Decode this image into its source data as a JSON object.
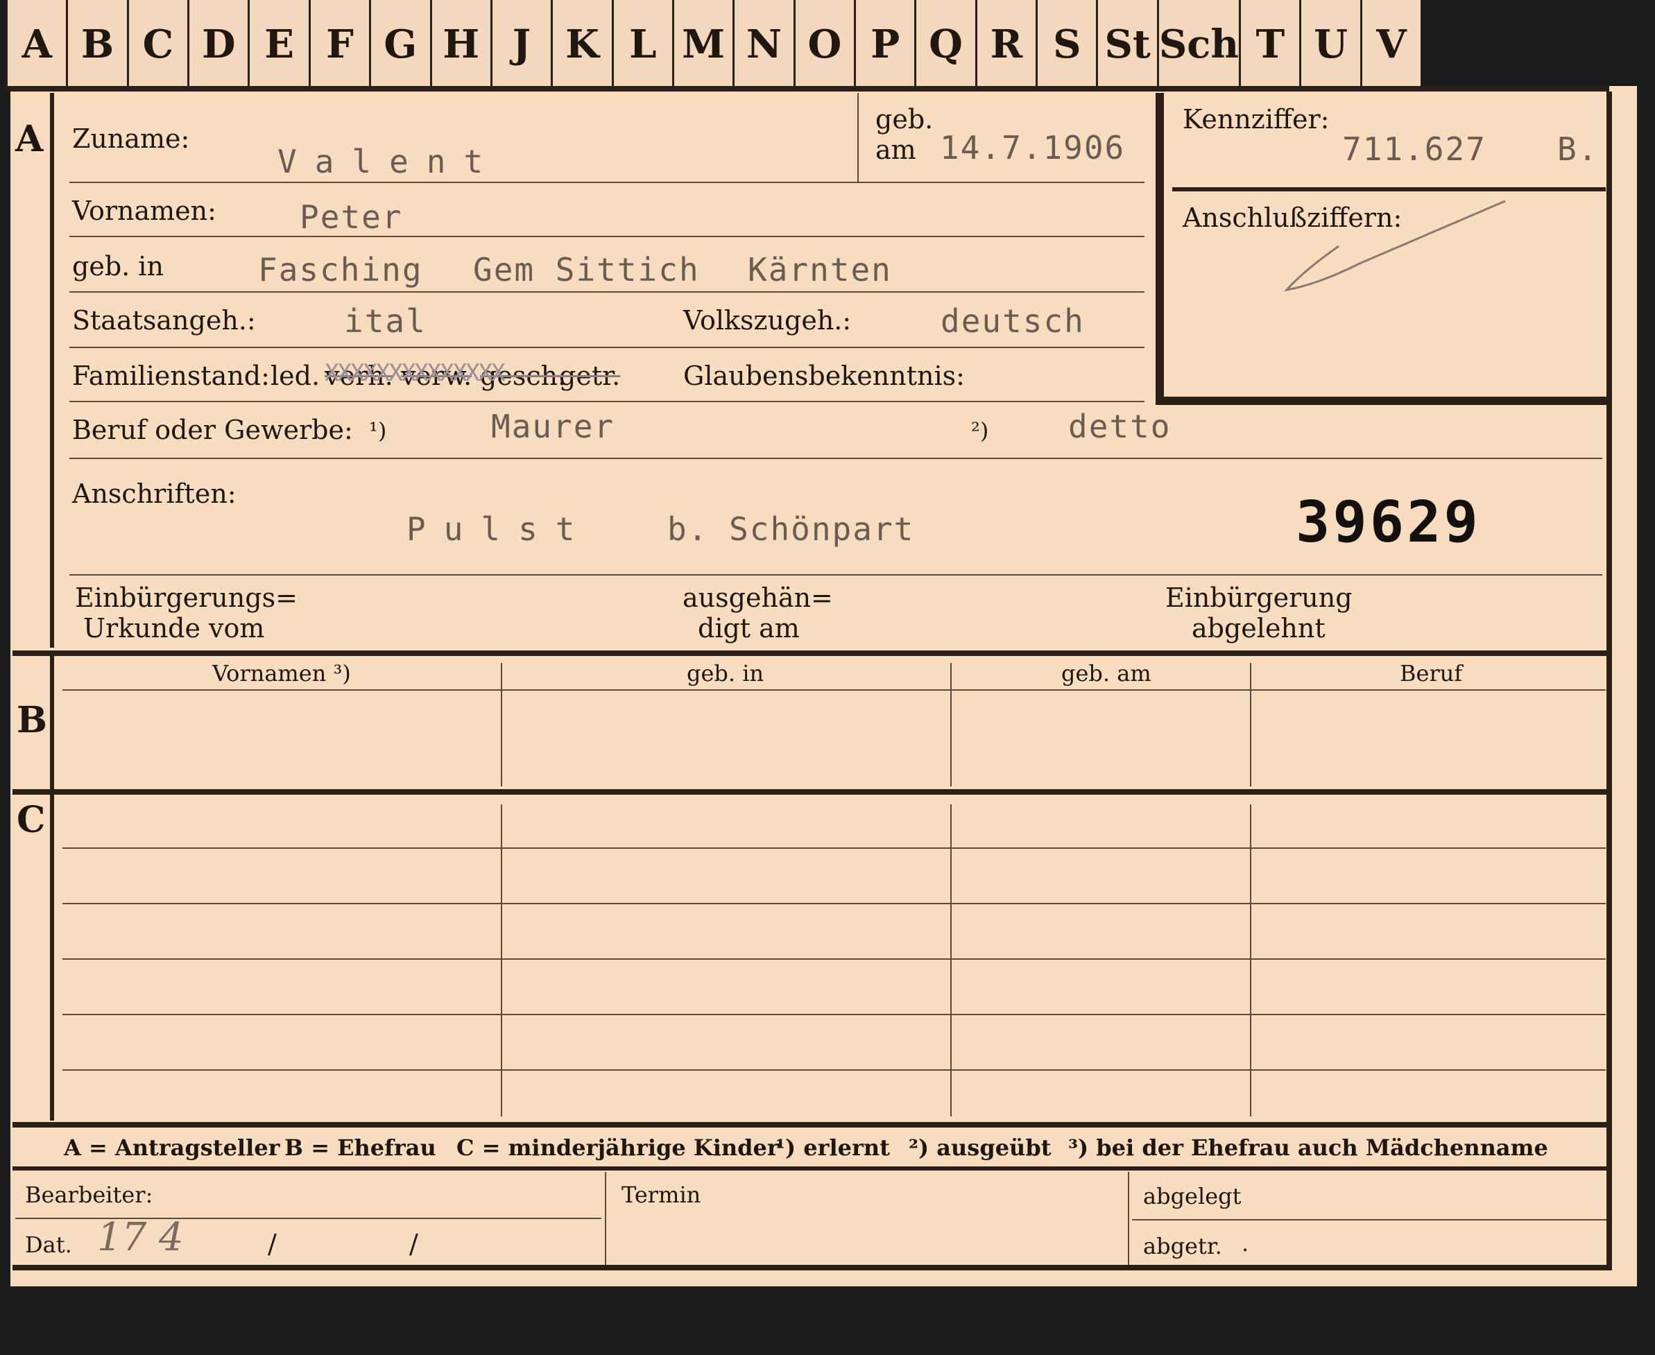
{
  "tabs": [
    "A",
    "B",
    "C",
    "D",
    "E",
    "F",
    "G",
    "H",
    "J",
    "K",
    "L",
    "M",
    "N",
    "O",
    "P",
    "Q",
    "R",
    "S",
    "St",
    "Sch",
    "T",
    "U",
    "V"
  ],
  "section_a": {
    "label": "A",
    "zuname_label": "Zuname:",
    "zuname": "Valent",
    "geb_label": "geb.",
    "am_label": "am",
    "geb_datum": "14.7.1906",
    "vornamen_label": "Vornamen:",
    "vornamen": "Peter",
    "gebin_label": "geb. in",
    "gebin_place": "Fasching",
    "gebin_gem": "Gem Sittich",
    "gebin_land": "Kärnten",
    "staat_label": "Staatsangeh.:",
    "staat": "ital",
    "volk_label": "Volkszugeh.:",
    "volk": "deutsch",
    "familie_label": "Familienstand:",
    "familie_led": "led.",
    "familie_verh": "verh.",
    "familie_verw": "verw.",
    "familie_gesch": "gesch.",
    "familie_getr": "getr.",
    "familie_xs": "XXXXXXXXXXXXXX",
    "glaube_label": "Glaubensbekenntnis:",
    "beruf_label": "Beruf oder Gewerbe:",
    "beruf_note1": "¹)",
    "beruf1": "Maurer",
    "beruf_note2": "²)",
    "beruf2": "detto",
    "anschrift_label": "Anschriften:",
    "anschrift": "Pulst",
    "anschrift2": "b. Schönpart",
    "number": "39629",
    "einb_label1": "Einbürgerungs=",
    "einb_label2": "Urkunde vom",
    "ausgeh_label1": "ausgehän=",
    "ausgeh_label2": "digt am",
    "abgelehnt_label1": "Einbürgerung",
    "abgelehnt_label2": "abgelehnt"
  },
  "kennziffer": {
    "label": "Kennziffer:",
    "value": "711.627",
    "suffix": "B.",
    "anschluss_label": "Anschlußziffern:"
  },
  "section_b": {
    "label": "B",
    "columns": [
      "Vornamen ³)",
      "geb. in",
      "geb. am",
      "Beruf"
    ]
  },
  "section_c": {
    "label": "C"
  },
  "legend": {
    "a": "A = Antragsteller",
    "b": "B = Ehefrau",
    "c": "C = minderjährige Kinder",
    "n1": "¹) erlernt",
    "n2": "²) ausgeübt",
    "n3": "³) bei der Ehefrau auch Mädchenname"
  },
  "footer": {
    "bearbeiter_label": "Bearbeiter:",
    "dat_label": "Dat.",
    "dat_value": "17 4",
    "slash1": "/",
    "slash2": "/",
    "termin_label": "Termin",
    "abgelegt_label": "abgelegt",
    "abgetr_label": "abgetr.",
    "abgetr_dot": "."
  }
}
